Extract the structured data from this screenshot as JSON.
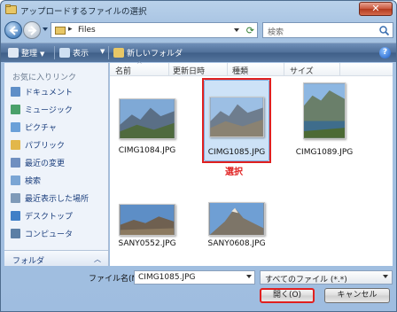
{
  "window": {
    "title": "アップロードするファイルの選択",
    "close_symbol": "✕"
  },
  "nav": {
    "address_path": "Files",
    "address_separator": "▸",
    "search_placeholder": "検索"
  },
  "toolbar": {
    "organize_label": "整理",
    "view_label": "表示",
    "new_folder_label": "新しいフォルダ",
    "help_symbol": "?"
  },
  "sidebar": {
    "heading": "お気に入りリンク",
    "items": [
      {
        "label": "ドキュメント",
        "icon": "documents-icon",
        "color": "#5f8fc8"
      },
      {
        "label": "ミュージック",
        "icon": "music-icon",
        "color": "#4aa06a"
      },
      {
        "label": "ピクチャ",
        "icon": "pictures-icon",
        "color": "#6aa0d8"
      },
      {
        "label": "パブリック",
        "icon": "public-folder-icon",
        "color": "#e2b74a"
      },
      {
        "label": "最近の変更",
        "icon": "recent-changes-icon",
        "color": "#6f8fc0"
      },
      {
        "label": "検索",
        "icon": "search-folder-icon",
        "color": "#7aa5d4"
      },
      {
        "label": "最近表示した場所",
        "icon": "recent-places-icon",
        "color": "#7f9ab8"
      },
      {
        "label": "デスクトップ",
        "icon": "desktop-icon",
        "color": "#3f7fc7"
      },
      {
        "label": "コンピュータ",
        "icon": "computer-icon",
        "color": "#5c7fa5"
      }
    ],
    "folder_bar_label": "フォルダ",
    "folder_bar_chevron": "︿"
  },
  "columns": [
    "名前",
    "更新日時",
    "種類",
    "サイズ"
  ],
  "files": [
    {
      "name": "CIMG1084.JPG",
      "selected": false
    },
    {
      "name": "CIMG1085.JPG",
      "selected": true
    },
    {
      "name": "CIMG1089.JPG",
      "selected": false
    },
    {
      "name": "SANY0552.JPG",
      "selected": false
    },
    {
      "name": "SANY0608.JPG",
      "selected": false
    }
  ],
  "annotation": {
    "selected_label": "選択",
    "color": "#e02020"
  },
  "bottom": {
    "filename_label": "ファイル名(N):",
    "filename_value": "CIMG1085.JPG",
    "filetype_value": "すべてのファイル (*.*)",
    "open_button": "開く(O)",
    "cancel_button": "キャンセル"
  }
}
